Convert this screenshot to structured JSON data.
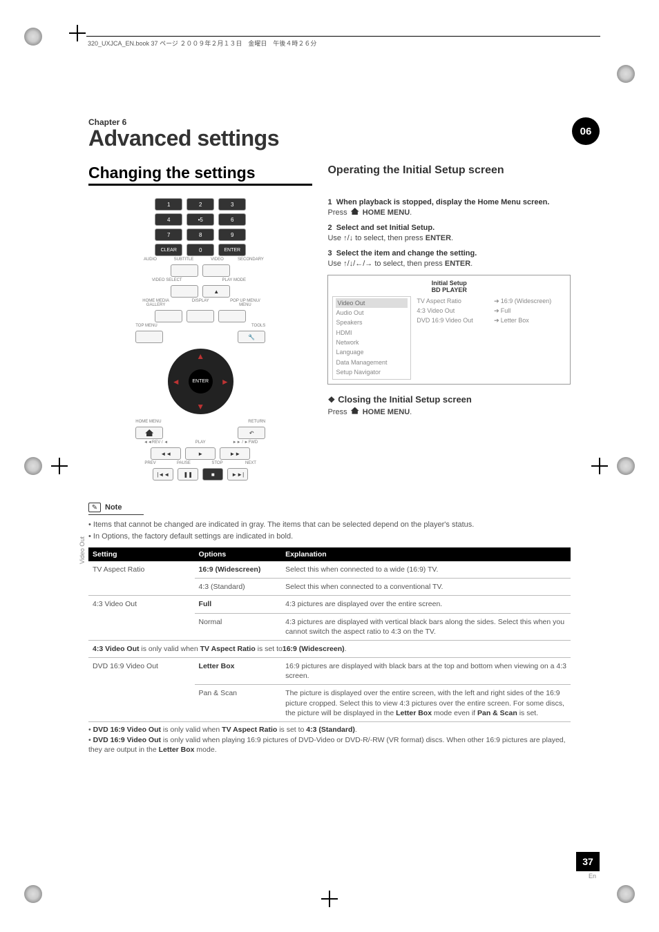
{
  "print": {
    "topmeta": "320_UXJCA_EN.book  37 ページ  ２００９年２月１３日　金曜日　午後４時２６分",
    "badge": "06",
    "pagenum": "37",
    "lang": "En"
  },
  "chapter": {
    "label": "Chapter 6",
    "title": "Advanced settings"
  },
  "section_left": "Changing the settings",
  "section_right": "Operating the Initial Setup screen",
  "remote": {
    "k1": "1",
    "k2": "2",
    "k3": "3",
    "k4": "4",
    "k5": "•5",
    "k6": "6",
    "k7": "7",
    "k8": "8",
    "k9": "9",
    "k0": "0",
    "clear": "CLEAR",
    "enterk": "ENTER",
    "l_audio": "AUDIO",
    "l_subtitle": "SUBTITLE",
    "l_video": "VIDEO",
    "l_2nd": "SECONDARY",
    "l_vsel": "VIDEO SELECT",
    "l_pmode": "PLAY MODE",
    "l_hmg": "HOME MEDIA GALLERY",
    "l_disp": "DISPLAY",
    "l_popup": "POP UP MENU/ MENU",
    "l_top": "TOP MENU",
    "l_tools": "TOOLS",
    "enter_center": "ENTER",
    "home": "HOME MENU",
    "return": "RETURN",
    "play": "PLAY",
    "prev": "PREV",
    "pause": "PAUSE",
    "stop": "STOP",
    "next": "NEXT",
    "rev": "◄◄REV / ◄",
    "fwd": "►► / ►FWD"
  },
  "steps": {
    "s1_num": "1",
    "s1_txt": "When playback is stopped, display the Home Menu screen.",
    "s1_press": "Press ",
    "s1_home": " HOME MENU",
    "s2_num": "2",
    "s2_txt": "Select and set Initial Setup.",
    "s2_body_a": "Use ",
    "s2_body_b": " to select, then press ",
    "s2_enter": "ENTER",
    "s3_num": "3",
    "s3_txt": "Select the item and change the setting.",
    "s3_body_a": "Use ",
    "s3_body_b": " to select, then press "
  },
  "panel": {
    "title1": "Initial Setup",
    "title2": "BD PLAYER",
    "left": [
      "Video Out",
      "Audio Out",
      "Speakers",
      "HDMI",
      "Network",
      "Language",
      "Data Management",
      "Setup Navigator"
    ],
    "mid": [
      "TV Aspect Ratio",
      "4:3 Video Out",
      "DVD 16:9 Video Out"
    ],
    "right": [
      "16:9 (Widescreen)",
      "Full",
      "Letter Box"
    ]
  },
  "closing": {
    "heading": "Closing the Initial Setup screen",
    "press": "Press ",
    "home": " HOME MENU"
  },
  "note": {
    "label": "Note",
    "b1": "Items that cannot be changed are indicated in gray. The items that can be selected depend on the player's status.",
    "b2": "In Options, the factory default settings are indicated in bold."
  },
  "table": {
    "side": "Video Out",
    "h1": "Setting",
    "h2": "Options",
    "h3": "Explanation",
    "r1s": "TV Aspect Ratio",
    "r1o": "16:9 (Widescreen)",
    "r1e": "Select this when connected to a wide (16:9) TV.",
    "r2o": "4:3 (Standard)",
    "r2e": "Select this when connected to a conventional TV.",
    "r3s": "4:3 Video Out",
    "r3o": "Full",
    "r3e": "4:3 pictures are displayed over the entire screen.",
    "r4o": "Normal",
    "r4e": "4:3 pictures are displayed with vertical black bars along the sides. Select this when you cannot switch the aspect ratio to 4:3 on the TV.",
    "interA_a": "4:3 Video Out",
    "interA_b": " is only valid when ",
    "interA_c": "TV Aspect Ratio",
    "interA_d": " is set to",
    "interA_e": "16:9 (Widescreen)",
    "interA_f": ".",
    "r5s": "DVD 16:9 Video Out",
    "r5o": "Letter Box",
    "r5e": "16:9 pictures are displayed with black bars at the top and bottom when viewing on a 4:3 screen.",
    "r6o": "Pan & Scan",
    "r6e_a": "The picture is displayed over the entire screen, with the left and right sides of the 16:9 picture cropped. Select this to view 4:3 pictures over the entire screen. For some discs, the picture will be displayed in the ",
    "r6e_b": "Letter Box",
    "r6e_c": " mode even if ",
    "r6e_d": "Pan & Scan",
    "r6e_e": " is set."
  },
  "footnotes": {
    "f1_a": "• ",
    "f1_b": "DVD 16:9 Video Out",
    "f1_c": " is only valid when ",
    "f1_d": "TV Aspect Ratio",
    "f1_e": " is set to ",
    "f1_f": "4:3 (Standard)",
    "f1_g": ".",
    "f2_a": "• ",
    "f2_b": "DVD 16:9 Video Out",
    "f2_c": " is only valid when playing 16:9 pictures of DVD-Video or DVD-R/-RW (VR format) discs. When other 16:9 pictures are played, they are output in the ",
    "f2_d": "Letter Box",
    "f2_e": " mode."
  }
}
